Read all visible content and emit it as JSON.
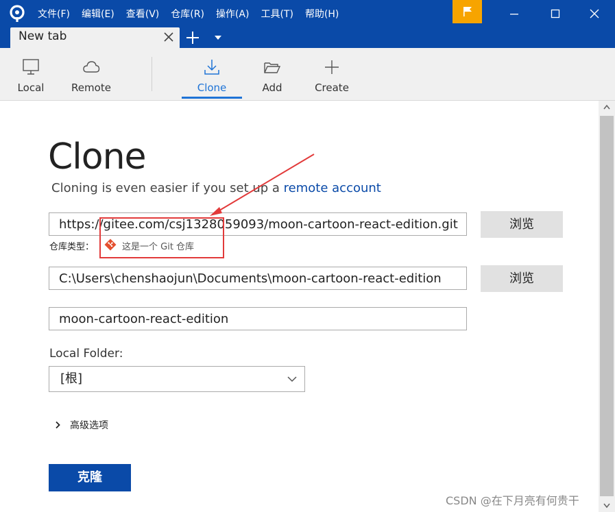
{
  "menu": {
    "items": [
      "文件(F)",
      "编辑(E)",
      "查看(V)",
      "仓库(R)",
      "操作(A)",
      "工具(T)",
      "帮助(H)"
    ]
  },
  "tab": {
    "label": "New tab"
  },
  "toolbar": {
    "local_label": "Local",
    "remote_label": "Remote",
    "clone_label": "Clone",
    "add_label": "Add",
    "create_label": "Create"
  },
  "clone": {
    "heading": "Clone",
    "subtitle_text": "Cloning is even easier if you set up a",
    "subtitle_link": "remote account",
    "source_url": "https://gitee.com/csj1328059093/moon-cartoon-react-edition.git",
    "browse_label": "浏览",
    "repo_type_label": "仓库类型：",
    "repo_type_desc": "这是一个 Git 仓库",
    "destination_path": "C:\\Users\\chenshaojun\\Documents\\moon-cartoon-react-edition",
    "name": "moon-cartoon-react-edition",
    "local_folder_label": "Local Folder:",
    "local_folder_value": "[根]",
    "advanced_label": "高级选项",
    "clone_button": "克隆"
  },
  "watermark": "CSDN @在下月亮有何贵干",
  "colors": {
    "brand": "#0a4aa8",
    "accent": "#1e73d6",
    "flag": "#f7a400",
    "annotation": "#e23a3a"
  }
}
